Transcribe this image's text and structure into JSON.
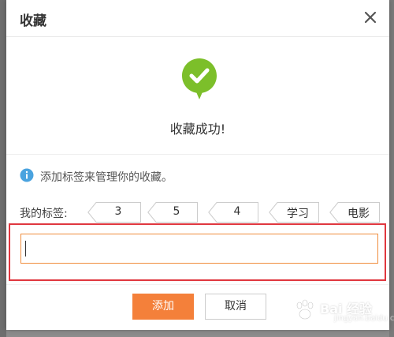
{
  "dialog": {
    "title": "收藏",
    "success_message": "收藏成功!",
    "hint": "添加标签来管理你的收藏。",
    "tags_label": "我的标签:",
    "tags": [
      {
        "label": "3"
      },
      {
        "label": "5"
      },
      {
        "label": "4"
      },
      {
        "label": "学习"
      },
      {
        "label": "电影"
      }
    ],
    "input": {
      "value": "",
      "placeholder": ""
    },
    "add_button": "添加",
    "cancel_button": "取消"
  },
  "watermark": {
    "brand": "Bai 经验",
    "sub": "jingyan.baidu.com"
  },
  "colors": {
    "success_green": "#7cbf2a",
    "info_blue": "#4aa3df",
    "primary_orange": "#f4803a",
    "highlight_red": "#e0373f"
  },
  "icons": [
    "close-icon",
    "success-check-icon",
    "info-icon",
    "baidu-paw-icon"
  ]
}
